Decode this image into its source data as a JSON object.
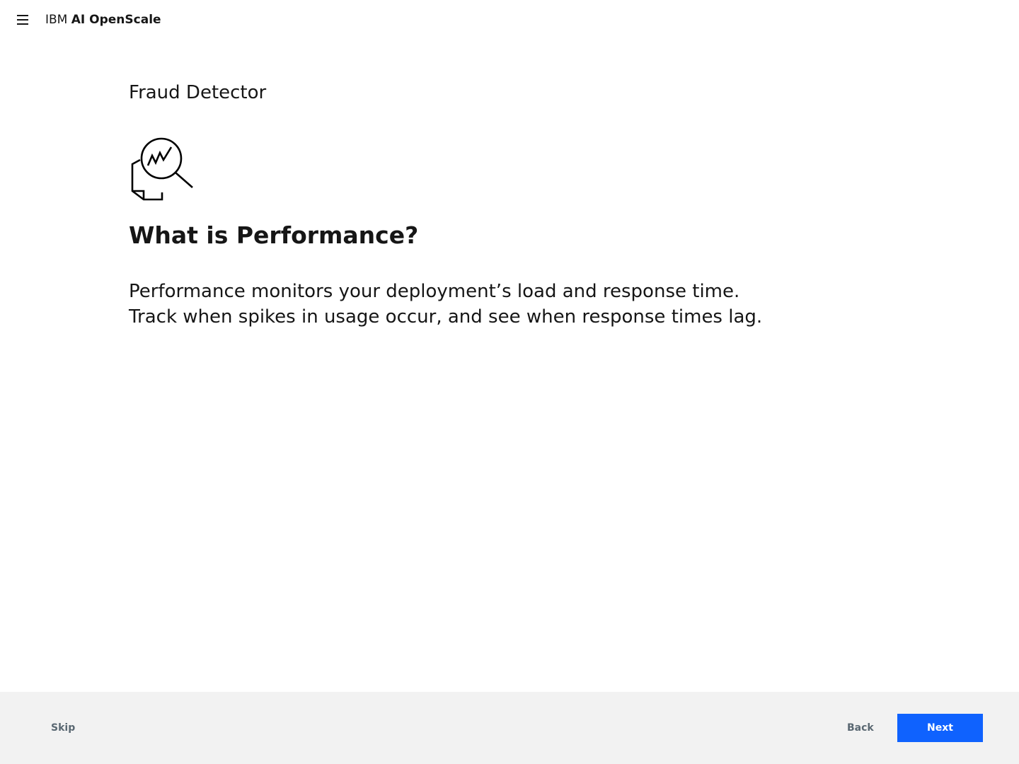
{
  "header": {
    "menu_icon": "hamburger-menu-icon",
    "brand_prefix": "IBM",
    "brand_name": "AI OpenScale"
  },
  "main": {
    "model_name": "Fraud Detector",
    "illustration_icon": "performance-magnifier-icon",
    "title": "What is Performance?",
    "description_lines": [
      "Performance monitors your deployment’s load and response time.",
      "Track when spikes in usage occur, and see when response times lag."
    ]
  },
  "footer": {
    "skip_label": "Skip",
    "back_label": "Back",
    "next_label": "Next"
  },
  "colors": {
    "primary": "#0f62fe",
    "footer_bg": "#f2f2f2",
    "secondary_text": "#5a6872",
    "text": "#161616"
  }
}
